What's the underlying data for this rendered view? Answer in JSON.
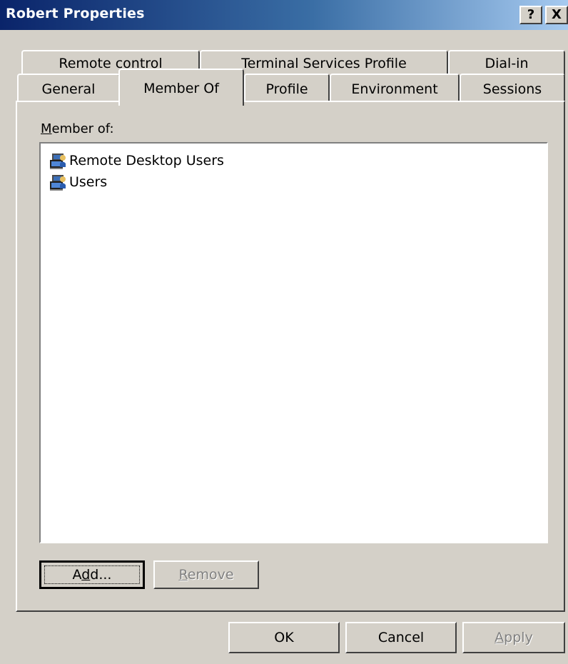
{
  "window": {
    "title": "Robert Properties",
    "help_glyph": "?",
    "close_glyph": "X"
  },
  "tabs": {
    "row1": [
      "Remote control",
      "Terminal Services Profile",
      "Dial-in"
    ],
    "row2": [
      "General",
      "Member Of",
      "Profile",
      "Environment",
      "Sessions"
    ],
    "active": "Member Of"
  },
  "member_of": {
    "label_accel": "M",
    "label_rest": "ember of:",
    "groups": [
      {
        "name": "Remote Desktop Users",
        "icon": "group-icon"
      },
      {
        "name": "Users",
        "icon": "group-icon"
      }
    ]
  },
  "buttons": {
    "add_pre": "A",
    "add_accel": "d",
    "add_post": "d...",
    "remove_accel": "R",
    "remove_rest": "emove",
    "ok": "OK",
    "cancel": "Cancel",
    "apply_accel": "A",
    "apply_rest": "pply"
  },
  "colors": {
    "titlebar_start": "#0a246a",
    "titlebar_end": "#a6caf0",
    "face": "#d4d0c8",
    "disabled_text": "#808080"
  }
}
